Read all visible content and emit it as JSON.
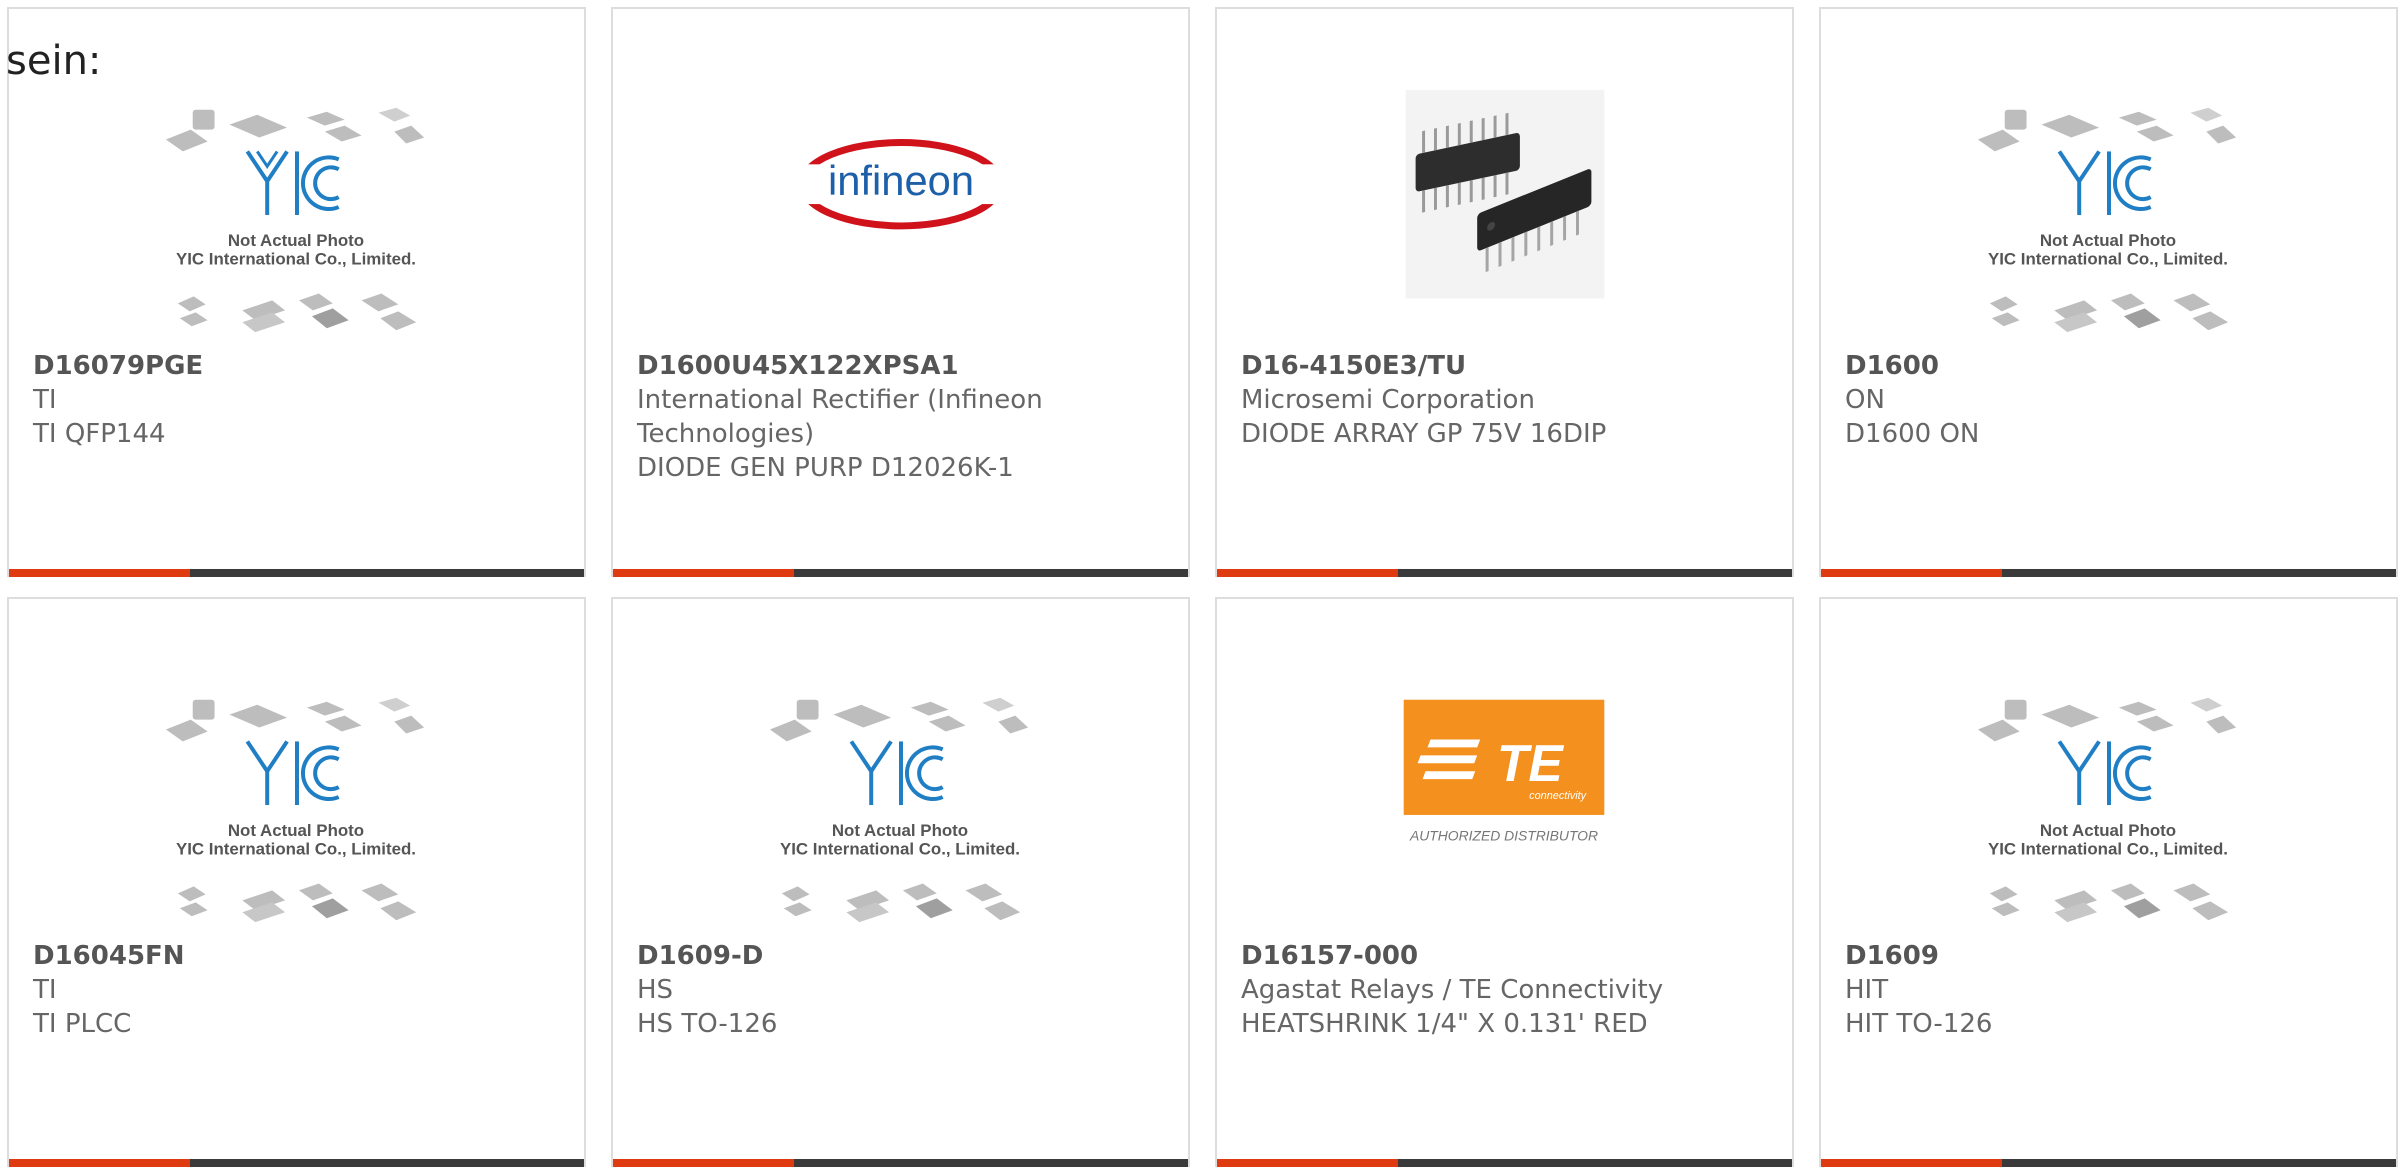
{
  "intro_text": "sein:",
  "colors": {
    "accent": "#e03a10",
    "bar": "#3a3a3a",
    "logo_blue": "#1f7ec4",
    "infineon_red": "#d0121b",
    "infineon_blue": "#1d5fa8",
    "te_orange": "#f4901e"
  },
  "placeholder": {
    "line1": "Not Actual Photo",
    "line2": "YIC International Co., Limited.",
    "logo_text": "YIC"
  },
  "brand_images": {
    "infineon": "infineon",
    "te": "TE",
    "te_sub": "connectivity",
    "te_caption": "AUTHORIZED DISTRIBUTOR"
  },
  "products": [
    {
      "part": "D16079PGE",
      "manufacturer": "TI",
      "description": "TI QFP144",
      "image": "placeholder"
    },
    {
      "part": "D1600U45X122XPSA1",
      "manufacturer": "International Rectifier (Infineon Technologies)",
      "description": "DIODE GEN PURP D12026K-1",
      "image": "infineon-logo"
    },
    {
      "part": "D16-4150E3/TU",
      "manufacturer": "Microsemi Corporation",
      "description": "DIODE ARRAY GP 75V 16DIP",
      "image": "dip-chip"
    },
    {
      "part": "D1600",
      "manufacturer": "ON",
      "description": "D1600 ON",
      "image": "placeholder"
    },
    {
      "part": "D16045FN",
      "manufacturer": "TI",
      "description": "TI PLCC",
      "image": "placeholder"
    },
    {
      "part": "D1609-D",
      "manufacturer": "HS",
      "description": "HS TO-126",
      "image": "placeholder"
    },
    {
      "part": "D16157-000",
      "manufacturer": "Agastat Relays / TE Connectivity",
      "description": "HEATSHRINK 1/4\" X 0.131' RED",
      "image": "te-logo"
    },
    {
      "part": "D1609",
      "manufacturer": "HIT",
      "description": "HIT TO-126",
      "image": "placeholder"
    }
  ]
}
